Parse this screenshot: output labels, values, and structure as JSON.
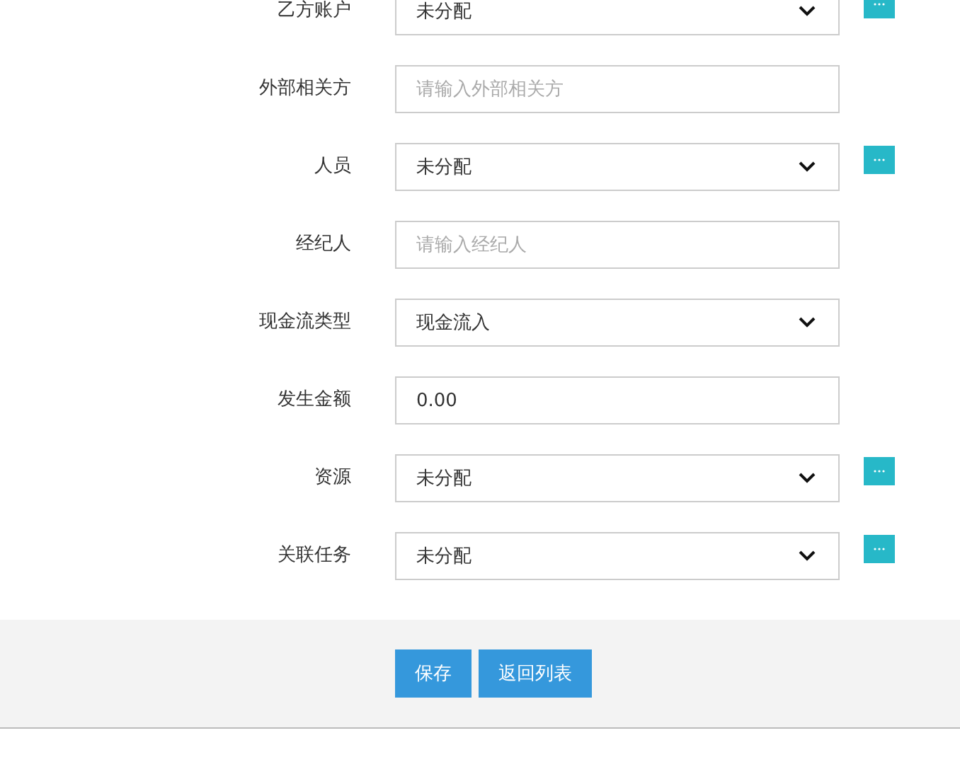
{
  "form": {
    "fields": [
      {
        "label": "乙方账户",
        "kind": "select",
        "value": "未分配",
        "picker": true
      },
      {
        "label": "外部相关方",
        "kind": "input",
        "placeholder": "请输入外部相关方",
        "picker": false
      },
      {
        "label": "人员",
        "kind": "select",
        "value": "未分配",
        "picker": true
      },
      {
        "label": "经纪人",
        "kind": "input",
        "placeholder": "请输入经纪人",
        "picker": false
      },
      {
        "label": "现金流类型",
        "kind": "select",
        "value": "现金流入",
        "picker": false
      },
      {
        "label": "发生金额",
        "kind": "input",
        "value": "0.00",
        "picker": false
      },
      {
        "label": "资源",
        "kind": "select",
        "value": "未分配",
        "picker": true
      },
      {
        "label": "关联任务",
        "kind": "select",
        "value": "未分配",
        "picker": true
      }
    ]
  },
  "buttons": [
    "保存",
    "返回列表"
  ]
}
